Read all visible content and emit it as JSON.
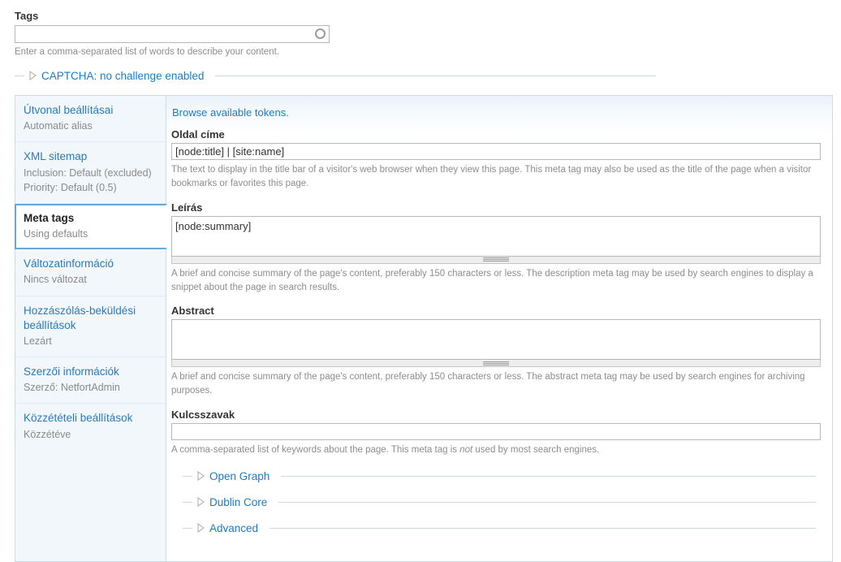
{
  "tags": {
    "label": "Tags",
    "value": "",
    "placeholder": "",
    "description": "Enter a comma-separated list of words to describe your content.",
    "throbber_icon": "circle-throbber-icon"
  },
  "captcha": {
    "legend": "CAPTCHA: no challenge enabled",
    "marker_icon": "collapsed-triangle-icon"
  },
  "vertical_tabs": [
    {
      "title": "Útvonal beállításai",
      "summary": "Automatic alias",
      "active": false
    },
    {
      "title": "XML sitemap",
      "summary": "Inclusion: Default (excluded)\nPriority: Default (0.5)",
      "active": false
    },
    {
      "title": "Meta tags",
      "summary": "Using defaults",
      "active": true
    },
    {
      "title": "Változatinformáció",
      "summary": "Nincs változat",
      "active": false
    },
    {
      "title": "Hozzászólás-beküldési beállítások",
      "summary": "Lezárt",
      "active": false
    },
    {
      "title": "Szerzői információk",
      "summary": "Szerző: NetfortAdmin",
      "active": false
    },
    {
      "title": "Közzétételi beállítások",
      "summary": "Közzétéve",
      "active": false
    }
  ],
  "panel": {
    "tokens_link": "Browse available tokens.",
    "fields": [
      {
        "label": "Oldal címe",
        "type": "text",
        "value": "[node:title] | [site:name]",
        "description": "The text to display in the title bar of a visitor's web browser when they view this page. This meta tag may also be used as the title of the page when a visitor bookmarks or favorites this page."
      },
      {
        "label": "Leírás",
        "type": "textarea",
        "value": "[node:summary]",
        "description": "A brief and concise summary of the page's content, preferably 150 characters or less. The description meta tag may be used by search engines to display a snippet about the page in search results."
      },
      {
        "label": "Abstract",
        "type": "textarea",
        "value": "",
        "description": "A brief and concise summary of the page's content, preferably 150 characters or less. The abstract meta tag may be used by search engines for archiving purposes."
      },
      {
        "label": "Kulcsszavak",
        "type": "text",
        "value": "",
        "description_pre": "A comma-separated list of keywords about the page. This meta tag is ",
        "description_em": "not",
        "description_post": " used by most search engines."
      }
    ],
    "collapsibles": [
      {
        "legend": "Open Graph",
        "marker_icon": "collapsed-triangle-icon"
      },
      {
        "legend": "Dublin Core",
        "marker_icon": "collapsed-triangle-icon"
      },
      {
        "legend": "Advanced",
        "marker_icon": "collapsed-triangle-icon"
      }
    ]
  },
  "colors": {
    "link": "#1d7bc4",
    "tab_bg": "#f2f7fb",
    "tab_border": "#cddbe6",
    "active_border": "#6aa7d8",
    "muted_text": "#8d8d8d"
  }
}
